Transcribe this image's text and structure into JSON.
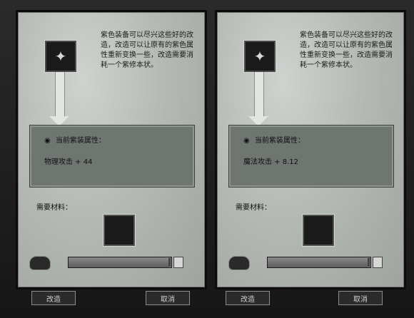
{
  "left": {
    "item_icon": "rune-icon",
    "description": "紫色装备可以尽兴这些好的改造，改造可以让原有的紫色属性重新变换一些，改造需要消耗一个紫修本状。",
    "attr_title": "当前紫装属性：",
    "attr_value": "物理攻击 + 44",
    "material_label": "需要材料：",
    "progress_fill": 0.97,
    "button_1": "改造",
    "button_2": "取消"
  },
  "right": {
    "item_icon": "rune-icon",
    "description": "紫色装备可以尽兴这些好的改造，改造可以让原有的紫色属性重新变换一些，改造需要消耗一个紫修本状。",
    "attr_title": "当前紫装属性：",
    "attr_value": "魔法攻击 + 8.12",
    "material_label": "需要材料：",
    "progress_fill": 0.97,
    "button_1": "改造",
    "button_2": "取消"
  }
}
